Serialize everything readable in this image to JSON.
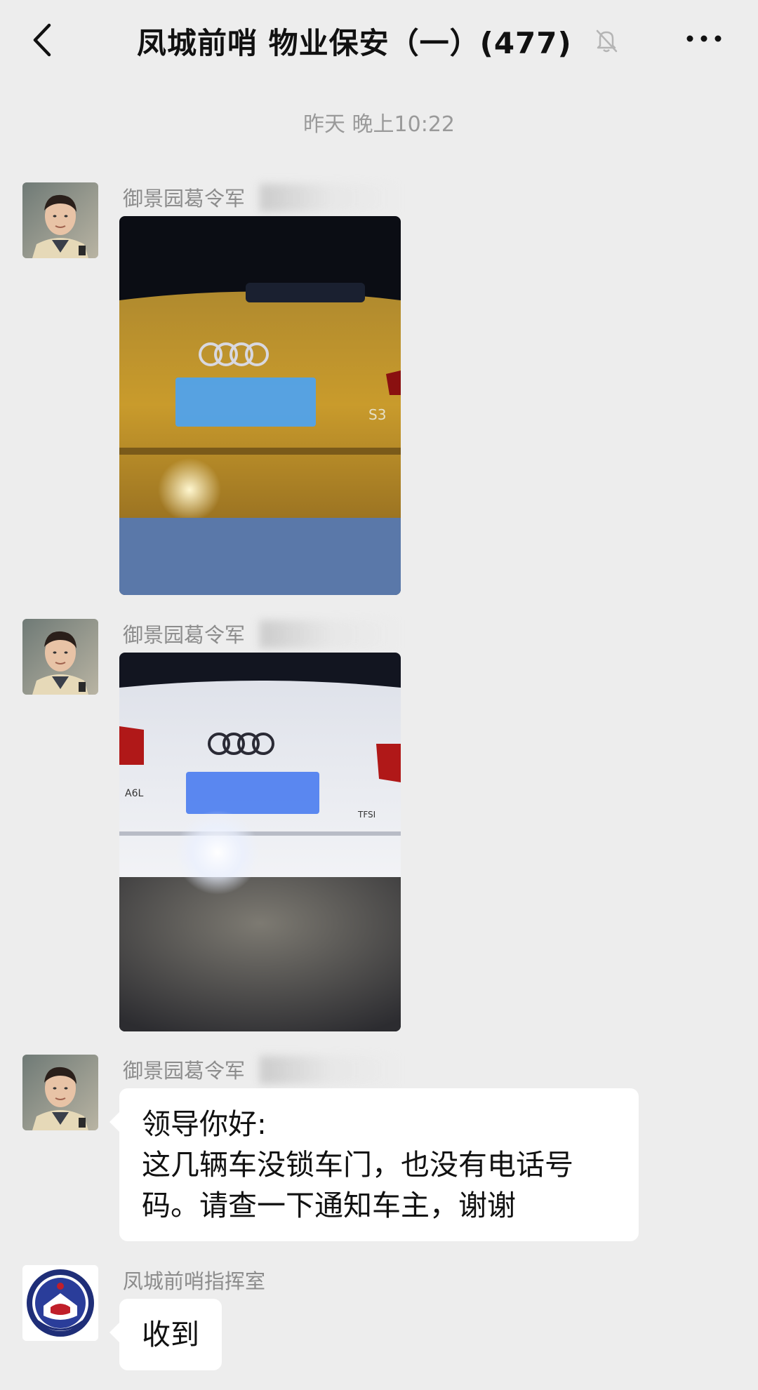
{
  "header": {
    "title": "凤城前哨 物业保安（一）(477)"
  },
  "timestamp": "昨天 晚上10:22",
  "messages": [
    {
      "sender": "御景园葛令军",
      "type": "image",
      "description_icon": "yellow-audi-photo"
    },
    {
      "sender": "御景园葛令军",
      "type": "image",
      "description_icon": "white-audi-photo"
    },
    {
      "sender": "御景园葛令军",
      "type": "text",
      "lines": [
        "领导你好:",
        "这几辆车没锁车门，也没有电话号",
        "码。请查一下通知车主，谢谢"
      ]
    },
    {
      "sender": "凤城前哨指挥室",
      "type": "text",
      "lines": [
        "收到"
      ]
    }
  ],
  "colors": {
    "background": "#ededed",
    "bubble": "#ffffff",
    "sender_text": "#8c8c8c",
    "timestamp_text": "#9a9a9a"
  }
}
